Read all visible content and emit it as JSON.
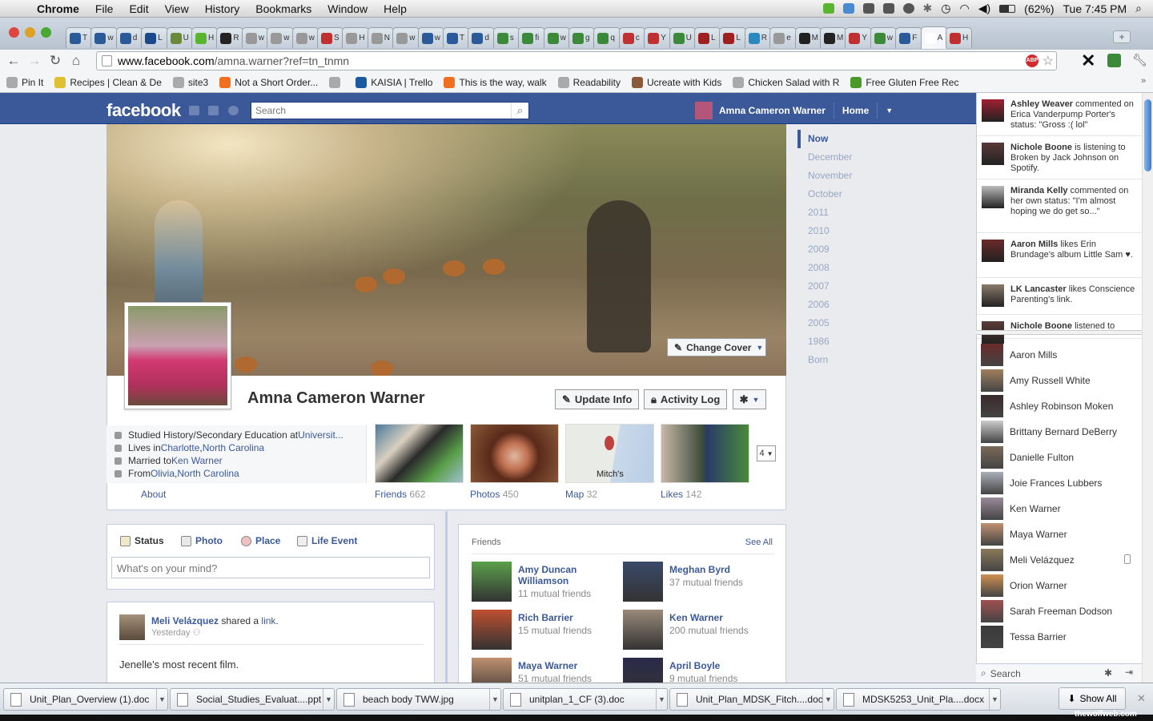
{
  "menubar": {
    "app": "Chrome",
    "items": [
      "File",
      "Edit",
      "View",
      "History",
      "Bookmarks",
      "Window",
      "Help"
    ],
    "battery": "(62%)",
    "clock": "Tue 7:45 PM"
  },
  "tabs": [
    {
      "letter": "T",
      "color": "#2a5a9a"
    },
    {
      "letter": "w",
      "color": "#2a5a9a"
    },
    {
      "letter": "d",
      "color": "#2a5a9a"
    },
    {
      "letter": "L",
      "color": "#1a4a8a"
    },
    {
      "letter": "U",
      "color": "#6a8a3a"
    },
    {
      "letter": "H",
      "color": "#5ab52e"
    },
    {
      "letter": "R",
      "color": "#222"
    },
    {
      "letter": "w",
      "color": "#999"
    },
    {
      "letter": "w",
      "color": "#999"
    },
    {
      "letter": "w",
      "color": "#999"
    },
    {
      "letter": "S",
      "color": "#c03030"
    },
    {
      "letter": "H",
      "color": "#999"
    },
    {
      "letter": "N",
      "color": "#999"
    },
    {
      "letter": "w",
      "color": "#999"
    },
    {
      "letter": "w",
      "color": "#2a5a9a"
    },
    {
      "letter": "T",
      "color": "#2a5a9a"
    },
    {
      "letter": "d",
      "color": "#2a5a9a"
    },
    {
      "letter": "s",
      "color": "#3a8a3a"
    },
    {
      "letter": "fi",
      "color": "#3a8a3a"
    },
    {
      "letter": "w",
      "color": "#3a8a3a"
    },
    {
      "letter": "g",
      "color": "#3a8a3a"
    },
    {
      "letter": "q",
      "color": "#3a8a3a"
    },
    {
      "letter": "c",
      "color": "#c03030"
    },
    {
      "letter": "Y",
      "color": "#c03030"
    },
    {
      "letter": "U",
      "color": "#3a8a3a"
    },
    {
      "letter": "L",
      "color": "#a02020"
    },
    {
      "letter": "L",
      "color": "#a02020"
    },
    {
      "letter": "R",
      "color": "#2a8ac0"
    },
    {
      "letter": "e",
      "color": "#999"
    },
    {
      "letter": "M",
      "color": "#222"
    },
    {
      "letter": "M",
      "color": "#222"
    },
    {
      "letter": "Y",
      "color": "#c03030"
    },
    {
      "letter": "w",
      "color": "#3a8a3a"
    },
    {
      "letter": "F",
      "color": "#2a5a9a"
    },
    {
      "letter": "A",
      "color": "#fff"
    },
    {
      "letter": "H",
      "color": "#c03030"
    }
  ],
  "url": {
    "host": "www.facebook.com",
    "path": "/amna.warner?ref=tn_tnmn"
  },
  "bookmarks": [
    {
      "label": "Pin It",
      "color": "#aaa"
    },
    {
      "label": "Recipes | Clean & De",
      "color": "#e0c030"
    },
    {
      "label": "site3",
      "color": "#aaa"
    },
    {
      "label": "Not a Short Order...",
      "color": "#f07020"
    },
    {
      "label": "",
      "color": "#aaa"
    },
    {
      "label": "KAISIA | Trello",
      "color": "#1a5aa0"
    },
    {
      "label": "This is the way, walk",
      "color": "#f07020"
    },
    {
      "label": "Readability",
      "color": "#aaa"
    },
    {
      "label": "Ucreate with Kids",
      "color": "#8a5a3a"
    },
    {
      "label": "Chicken Salad with R",
      "color": "#aaa"
    },
    {
      "label": "Free Gluten Free Rec",
      "color": "#4a9a2a"
    }
  ],
  "fb": {
    "logo": "facebook",
    "search_placeholder": "Search",
    "user_name": "Amna Cameron Warner",
    "home": "Home",
    "change_cover": "Change Cover",
    "profile_name": "Amna Cameron Warner",
    "update_info": "Update Info",
    "activity_log": "Activity Log",
    "about": [
      {
        "prefix": "Studied History/Secondary Education at ",
        "links": [
          "Universit..."
        ]
      },
      {
        "prefix": "Lives in ",
        "links": [
          "Charlotte",
          ", ",
          "North Carolina"
        ]
      },
      {
        "prefix": "Married to ",
        "links": [
          "Ken Warner"
        ]
      },
      {
        "prefix": "From ",
        "links": [
          "Olivia",
          ", ",
          "North Carolina"
        ]
      }
    ],
    "about_link": "About",
    "map_label": "Mitch's",
    "thumbs": [
      {
        "label": "Friends",
        "count": "662"
      },
      {
        "label": "Photos",
        "count": "450"
      },
      {
        "label": "Map",
        "count": "32"
      },
      {
        "label": "Likes",
        "count": "142"
      }
    ],
    "more_count": "4",
    "timeline": [
      "Now",
      "December",
      "November",
      "October",
      "2011",
      "2010",
      "2009",
      "2008",
      "2007",
      "2006",
      "2005",
      "1986",
      "Born"
    ],
    "composer": {
      "tabs": [
        "Status",
        "Photo",
        "Place",
        "Life Event"
      ],
      "placeholder": "What's on your mind?"
    },
    "story": {
      "actor": "Meli Velázquez",
      "verb": " shared a ",
      "object": "link",
      "time": "Yesterday",
      "text": "Jenelle's most recent film."
    },
    "friends_box": {
      "title": "Friends",
      "see_all": "See All",
      "items": [
        {
          "name": "Amy Duncan Williamson",
          "mutual": "11 mutual friends",
          "color": "#5aa04a"
        },
        {
          "name": "Meghan Byrd",
          "mutual": "37 mutual friends",
          "color": "#3a4a6a"
        },
        {
          "name": "Rich Barrier",
          "mutual": "15 mutual friends",
          "color": "#c05030"
        },
        {
          "name": "Ken Warner",
          "mutual": "200 mutual friends",
          "color": "#9a8a7a"
        },
        {
          "name": "Maya Warner",
          "mutual": "51 mutual friends",
          "color": "#c09070"
        },
        {
          "name": "April Boyle",
          "mutual": "9 mutual friends",
          "color": "#2a2a4a"
        }
      ]
    }
  },
  "ticker": [
    {
      "name": "Ashley Weaver",
      "text": " commented on Erica Vanderpump Porter's status: \"Gross :( lol\"",
      "color": "#a02030"
    },
    {
      "name": "Nichole Boone",
      "text": " is listening to Broken by Jack Johnson on Spotify.",
      "color": "#5a3a3a"
    },
    {
      "name": "Miranda Kelly",
      "text": " commented on her own status: \"I'm almost hoping we do get so...\"",
      "color": "#bbb"
    },
    {
      "name": "Aaron Mills",
      "text": " likes Erin Brundage's album Little Sam ♥.",
      "color": "#6a2a2a"
    },
    {
      "name": "LK Lancaster",
      "text": " likes Conscience Parenting's link.",
      "color": "#8a7a6a"
    },
    {
      "name": "Nichole Boone",
      "text": " listened to",
      "color": "#5a3a3a"
    }
  ],
  "chat": [
    {
      "name": "Aaron Mills",
      "color": "#6a2a2a"
    },
    {
      "name": "Amy Russell White",
      "color": "#a08060"
    },
    {
      "name": "Ashley Robinson Moken",
      "color": "#3a2a2a"
    },
    {
      "name": "Brittany Bernard DeBerry",
      "color": "#ccc"
    },
    {
      "name": "Danielle Fulton",
      "color": "#7a6a5a"
    },
    {
      "name": "Joie Frances Lubbers",
      "color": "#aab0b8"
    },
    {
      "name": "Ken Warner",
      "color": "#9a8a9a"
    },
    {
      "name": "Maya Warner",
      "color": "#c09070"
    },
    {
      "name": "Meli Velázquez",
      "color": "#8a7a5a"
    },
    {
      "name": "Orion Warner",
      "color": "#d09050"
    },
    {
      "name": "Sarah Freeman Dodson",
      "color": "#a05050"
    },
    {
      "name": "Tessa Barrier",
      "color": "#3a3a3a"
    }
  ],
  "chat_search": "Search",
  "downloads": [
    {
      "name": "Unit_Plan_Overview (1).doc"
    },
    {
      "name": "Social_Studies_Evaluat....ppt"
    },
    {
      "name": "beach body TWW.jpg"
    },
    {
      "name": "unitplan_1_CF (3).doc"
    },
    {
      "name": "Unit_Plan_MDSK_Fitch....doc"
    },
    {
      "name": "MDSK5253_Unit_Pla....docx"
    }
  ],
  "show_all": "Show All",
  "watermark": "thewolfweb.com"
}
